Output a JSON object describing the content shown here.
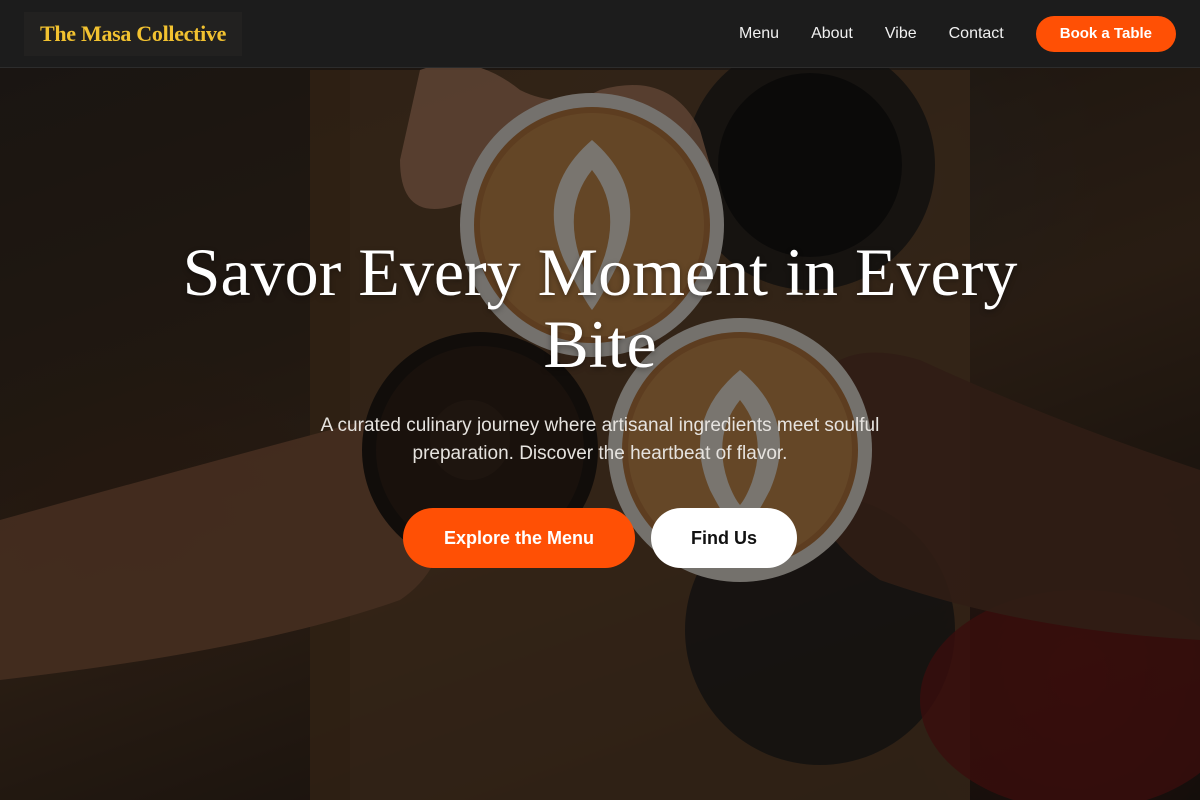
{
  "brand": {
    "name": "The Masa Collective",
    "accent_color": "#f2c230"
  },
  "nav": {
    "links": [
      {
        "label": "Menu"
      },
      {
        "label": "About"
      },
      {
        "label": "Vibe"
      },
      {
        "label": "Contact"
      }
    ],
    "cta_label": "Book a Table",
    "cta_color": "#ff5005"
  },
  "hero": {
    "title": "Savor Every Moment in Every Bite",
    "subtitle": "A curated culinary journey where artisanal ingredients meet soulful preparation. Discover the heartbeat of flavor.",
    "primary_button": "Explore the Menu",
    "secondary_button": "Find Us",
    "background_image": "coffee-cups-toast-photo"
  }
}
